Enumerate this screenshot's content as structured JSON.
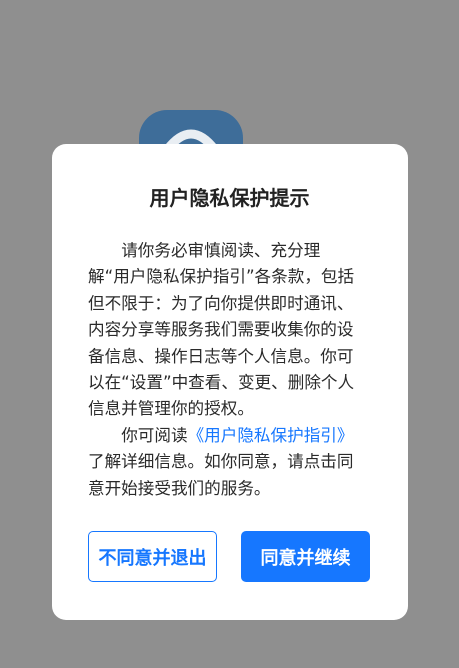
{
  "colors": {
    "overlay": "#8f8f8f",
    "dialog_bg": "#ffffff",
    "accent": "#1677ff",
    "app_icon_bg": "#3e6d99"
  },
  "background": {
    "app_icon": "app-logo-icon"
  },
  "dialog": {
    "title": "用户隐私保护提示",
    "paragraph1": "请你务必审慎阅读、充分理解“用户隐私保护指引”各条款，包括但不限于：为了向你提供即时通讯、内容分享等服务我们需要收集你的设备信息、操作日志等个人信息。你可以在“设置”中查看、变更、删除个人信息并管理你的授权。",
    "paragraph2_prefix": "你可阅读",
    "paragraph2_link": "《用户隐私保护指引》",
    "paragraph2_suffix": "了解详细信息。如你同意，请点击同意开始接受我们的服务。",
    "decline_label": "不同意并退出",
    "accept_label": "同意并继续"
  }
}
